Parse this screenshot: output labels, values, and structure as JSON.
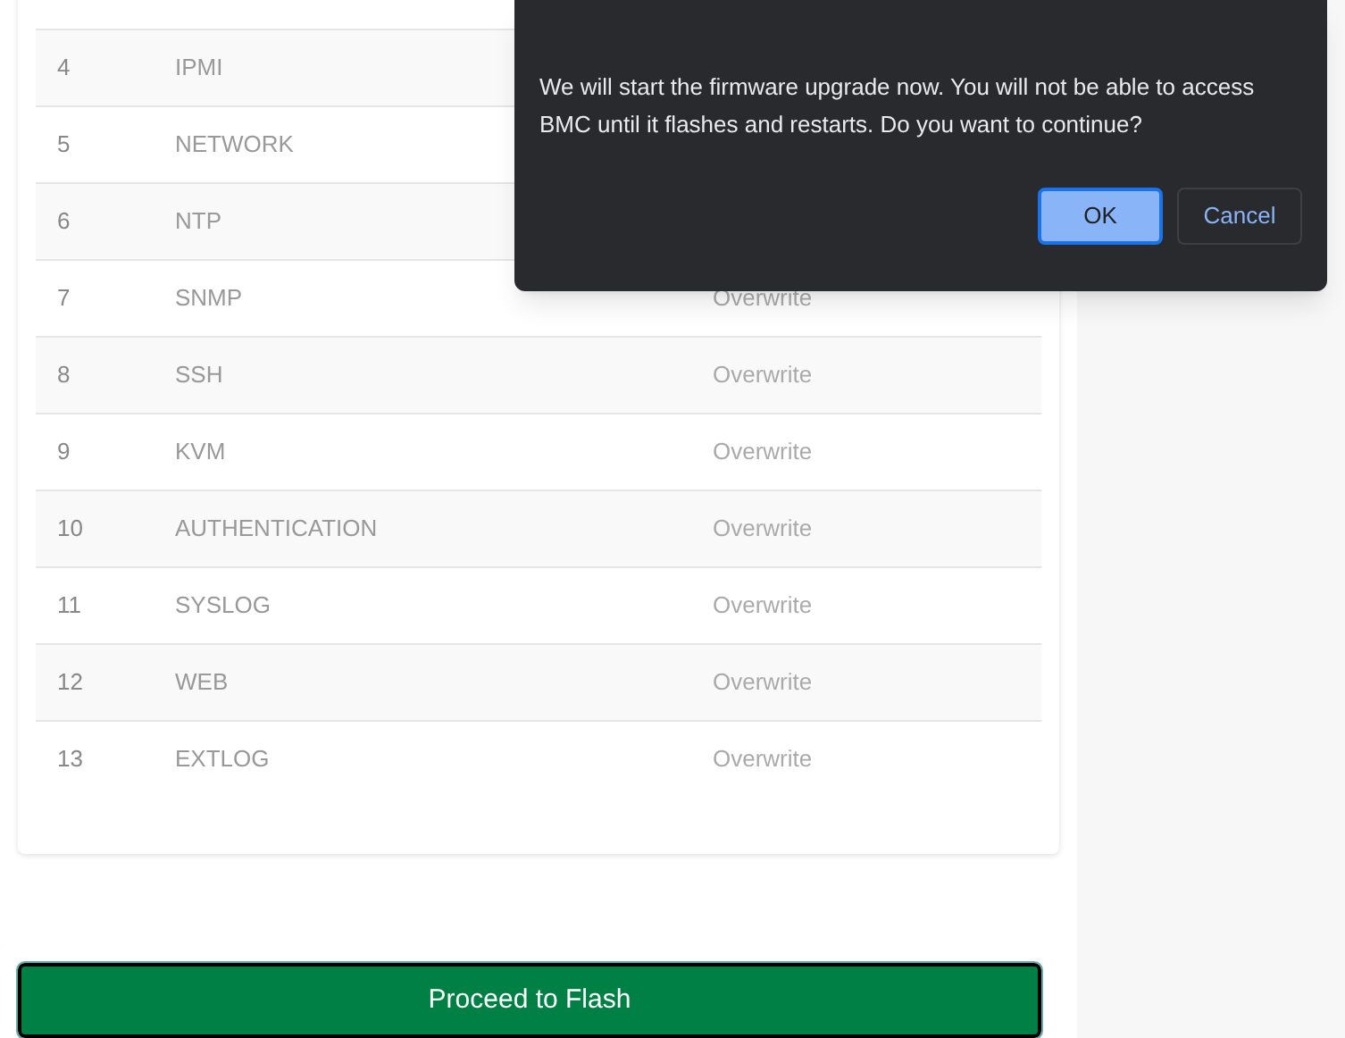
{
  "table": {
    "rows": [
      {
        "index": "4",
        "name": "IPMI"
      },
      {
        "index": "5",
        "name": "NETWORK"
      },
      {
        "index": "6",
        "name": "NTP"
      },
      {
        "index": "7",
        "name": "SNMP",
        "action": "Overwrite"
      },
      {
        "index": "8",
        "name": "SSH",
        "action": "Overwrite"
      },
      {
        "index": "9",
        "name": "KVM",
        "action": "Overwrite"
      },
      {
        "index": "10",
        "name": "AUTHENTICATION",
        "action": "Overwrite"
      },
      {
        "index": "11",
        "name": "SYSLOG",
        "action": "Overwrite"
      },
      {
        "index": "12",
        "name": "WEB",
        "action": "Overwrite"
      },
      {
        "index": "13",
        "name": "EXTLOG",
        "action": "Overwrite"
      }
    ]
  },
  "proceed_button": "Proceed to Flash",
  "dialog": {
    "message": "We will start the firmware upgrade now. You will not be able to access BMC until it flashes and restarts. Do you want to continue?",
    "buttons": [
      {
        "label": "OK",
        "selected": true
      },
      {
        "label": "Cancel",
        "selected": false
      }
    ]
  }
}
